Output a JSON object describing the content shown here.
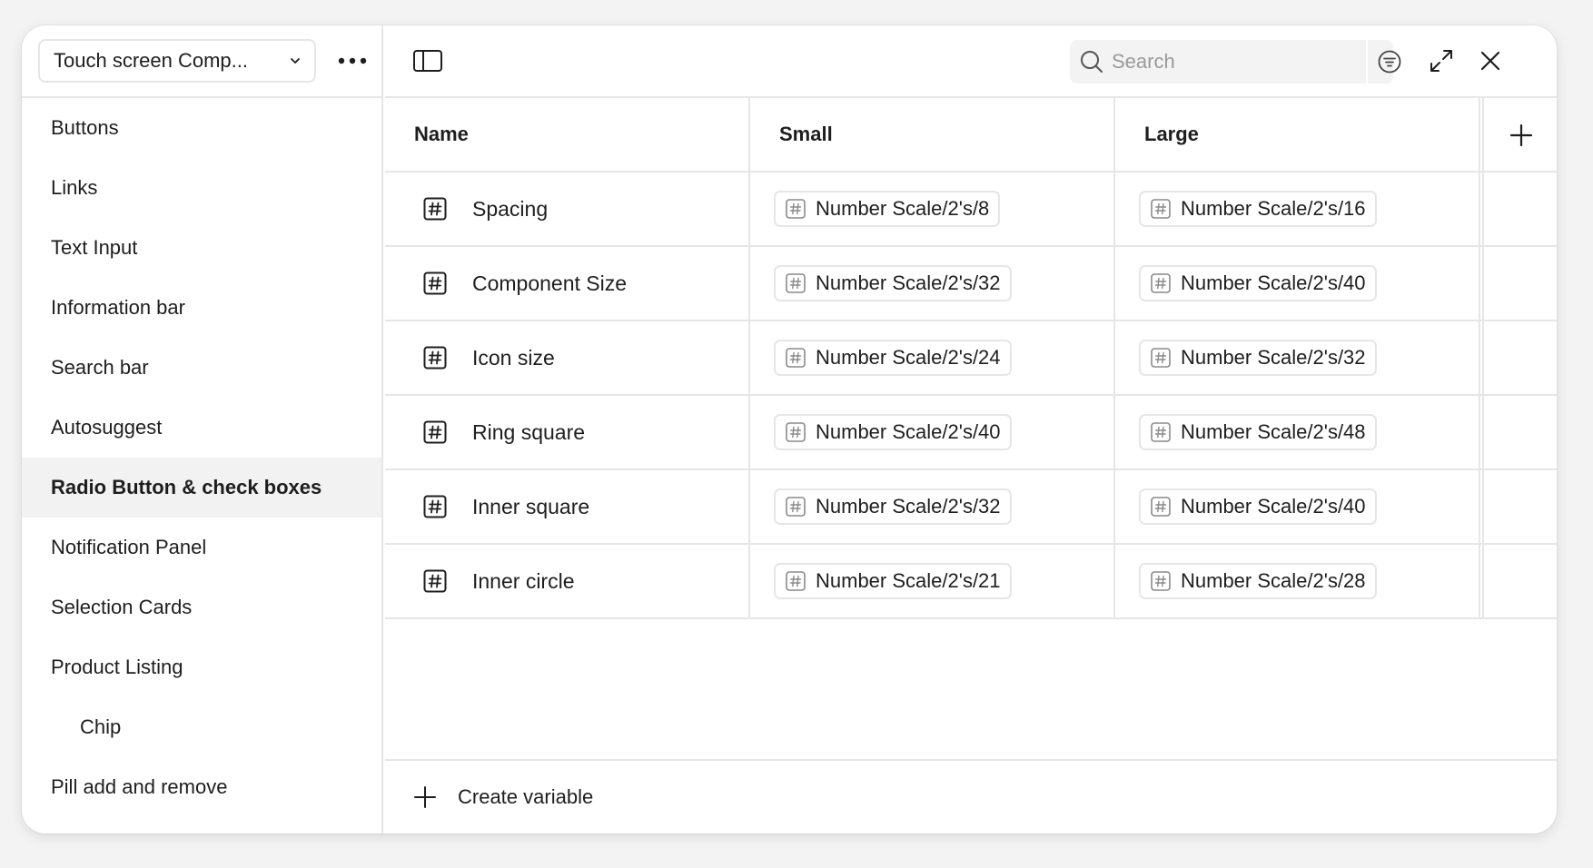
{
  "sidebar": {
    "collection_label": "Touch screen Comp...",
    "groups": [
      {
        "label": "Buttons"
      },
      {
        "label": "Links"
      },
      {
        "label": "Text Input"
      },
      {
        "label": "Information bar"
      },
      {
        "label": "Search bar"
      },
      {
        "label": "Autosuggest"
      },
      {
        "label": "Radio Button & check boxes",
        "active": true
      },
      {
        "label": "Notification Panel"
      },
      {
        "label": "Selection Cards"
      },
      {
        "label": "Product Listing"
      },
      {
        "label": "Chip",
        "nested": true
      },
      {
        "label": "Pill add and remove"
      }
    ]
  },
  "toolbar": {
    "search_placeholder": "Search"
  },
  "table": {
    "columns": [
      "Name",
      "Small",
      "Large"
    ],
    "rows": [
      {
        "name": "Spacing",
        "small": "Number Scale/2's/8",
        "large": "Number Scale/2's/16"
      },
      {
        "name": "Component Size",
        "small": "Number Scale/2's/32",
        "large": "Number Scale/2's/40"
      },
      {
        "name": "Icon size",
        "small": "Number Scale/2's/24",
        "large": "Number Scale/2's/32"
      },
      {
        "name": "Ring square",
        "small": "Number Scale/2's/40",
        "large": "Number Scale/2's/48"
      },
      {
        "name": "Inner square",
        "small": "Number Scale/2's/32",
        "large": "Number Scale/2's/40"
      },
      {
        "name": "Inner circle",
        "small": "Number Scale/2's/21",
        "large": "Number Scale/2's/28"
      }
    ]
  },
  "footer": {
    "create_label": "Create variable"
  },
  "icons": {
    "collection_chevron": "chevron-down-icon",
    "more": "more-icon",
    "sidebar_toggle": "sidebar-toggle-icon",
    "search": "search-icon",
    "filter": "filter-icon",
    "expand": "expand-icon",
    "close": "close-icon",
    "add_mode": "plus-icon",
    "variable": "number-variable-icon",
    "alias": "number-variable-icon",
    "create": "plus-icon"
  }
}
